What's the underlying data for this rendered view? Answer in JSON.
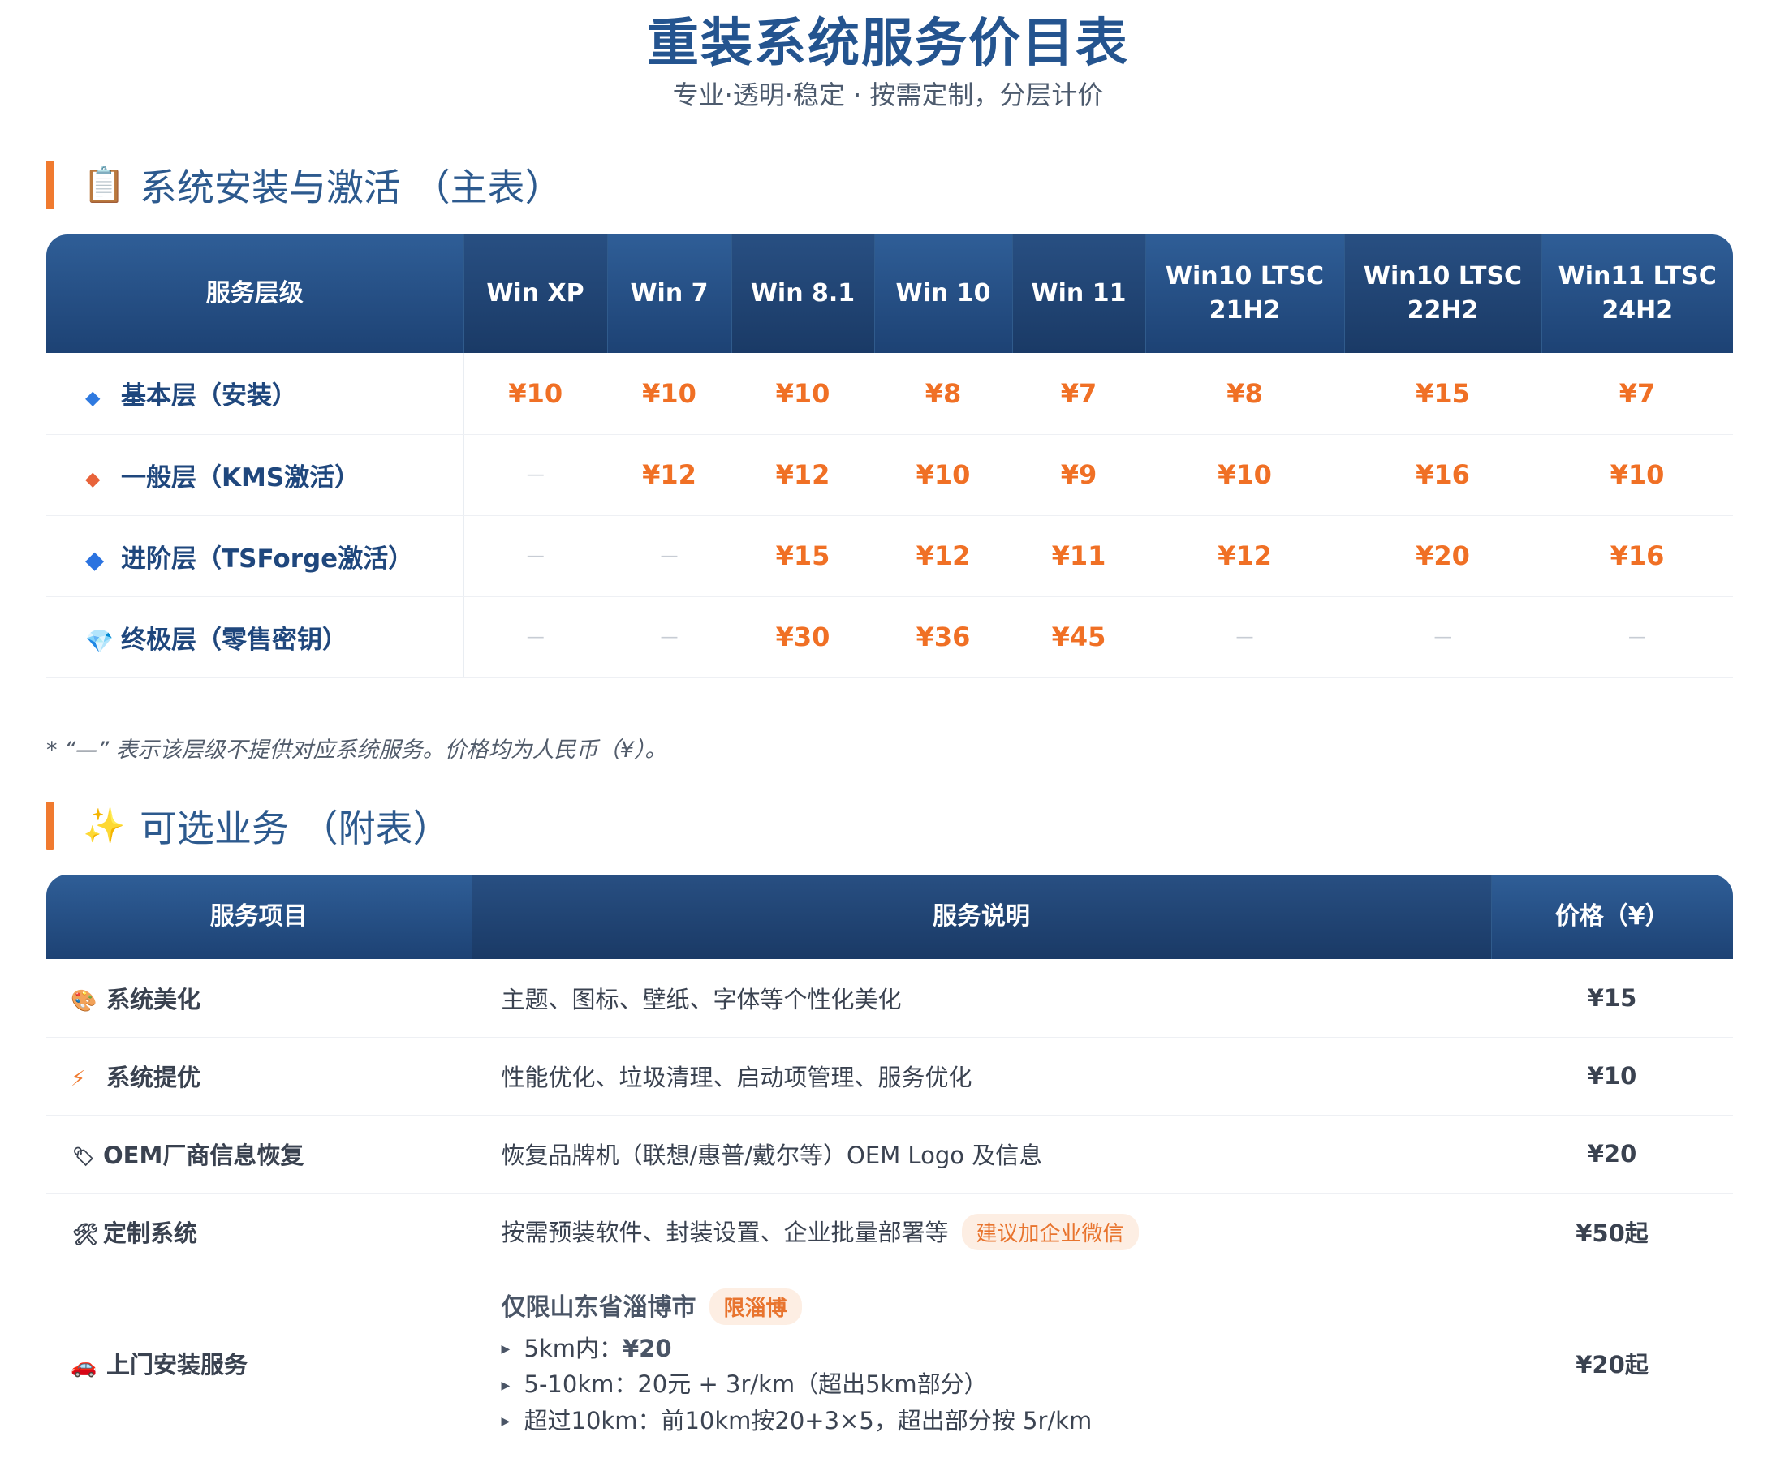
{
  "header": {
    "title": "重装系统服务价目表",
    "subtitle": "专业·透明·稳定 · 按需定制，分层计价"
  },
  "section_main": {
    "icon": "clipboard-icon",
    "title": "系统安装与激活 （主表）"
  },
  "main_table": {
    "columns": [
      {
        "l1": "服务层级",
        "l2": ""
      },
      {
        "l1": "Win XP",
        "l2": ""
      },
      {
        "l1": "Win 7",
        "l2": ""
      },
      {
        "l1": "Win 8.1",
        "l2": ""
      },
      {
        "l1": "Win 10",
        "l2": ""
      },
      {
        "l1": "Win 11",
        "l2": ""
      },
      {
        "l1": "Win10 LTSC",
        "l2": "21H2"
      },
      {
        "l1": "Win10 LTSC",
        "l2": "22H2"
      },
      {
        "l1": "Win11 LTSC",
        "l2": "24H2"
      }
    ],
    "rows": [
      {
        "icon": "◆",
        "tier": "基本层（安装）",
        "cells": [
          "¥10",
          "¥10",
          "¥10",
          "¥8",
          "¥7",
          "¥8",
          "¥15",
          "¥7"
        ]
      },
      {
        "icon": "◆",
        "tier": "一般层（KMS激活）",
        "cells": [
          "—",
          "¥12",
          "¥12",
          "¥10",
          "¥9",
          "¥10",
          "¥16",
          "¥10"
        ]
      },
      {
        "icon": "◆",
        "tier": "进阶层（TSForge激活）",
        "cells": [
          "—",
          "—",
          "¥15",
          "¥12",
          "¥11",
          "¥12",
          "¥20",
          "¥16"
        ]
      },
      {
        "icon": "💎",
        "tier": "终极层（零售密钥）",
        "cells": [
          "—",
          "—",
          "¥30",
          "¥36",
          "¥45",
          "—",
          "—",
          "—"
        ]
      }
    ]
  },
  "note": "* “—” 表示该层级不提供对应系统服务。价格均为人民币（¥）。",
  "section_optional": {
    "icon": "sparkles-icon",
    "title": "可选业务 （附表）"
  },
  "optional_table": {
    "headers": [
      "服务项目",
      "服务说明",
      "价格（¥）"
    ],
    "rows": [
      {
        "icon": "🎨",
        "name": "系统美化",
        "desc": "主题、图标、壁纸、字体等个性化美化",
        "tag": "",
        "price": "¥15"
      },
      {
        "icon": "⚡",
        "name": "系统提优",
        "desc": "性能优化、垃圾清理、启动项管理、服务优化",
        "tag": "",
        "price": "¥10"
      },
      {
        "icon": "🏷",
        "name": "OEM厂商信息恢复",
        "desc": "恢复品牌机（联想/惠普/戴尔等）OEM Logo 及信息",
        "tag": "",
        "price": "¥20"
      },
      {
        "icon": "🛠",
        "name": "定制系统",
        "desc": "按需预装软件、封装设置、企业批量部署等",
        "tag": "建议加企业微信",
        "price": "¥50起"
      }
    ],
    "onsite": {
      "icon": "🚗",
      "name": "上门安装服务",
      "region": "仅限山东省淄博市",
      "tag": "限淄博",
      "line1_prefix": "5km内：",
      "line1_value": "¥20",
      "line2": "5-10km：20元 + 3r/km（超出5km部分）",
      "line3": "超过10km：前10km按20+3×5，超出部分按 5r/km",
      "price": "¥20起"
    }
  }
}
